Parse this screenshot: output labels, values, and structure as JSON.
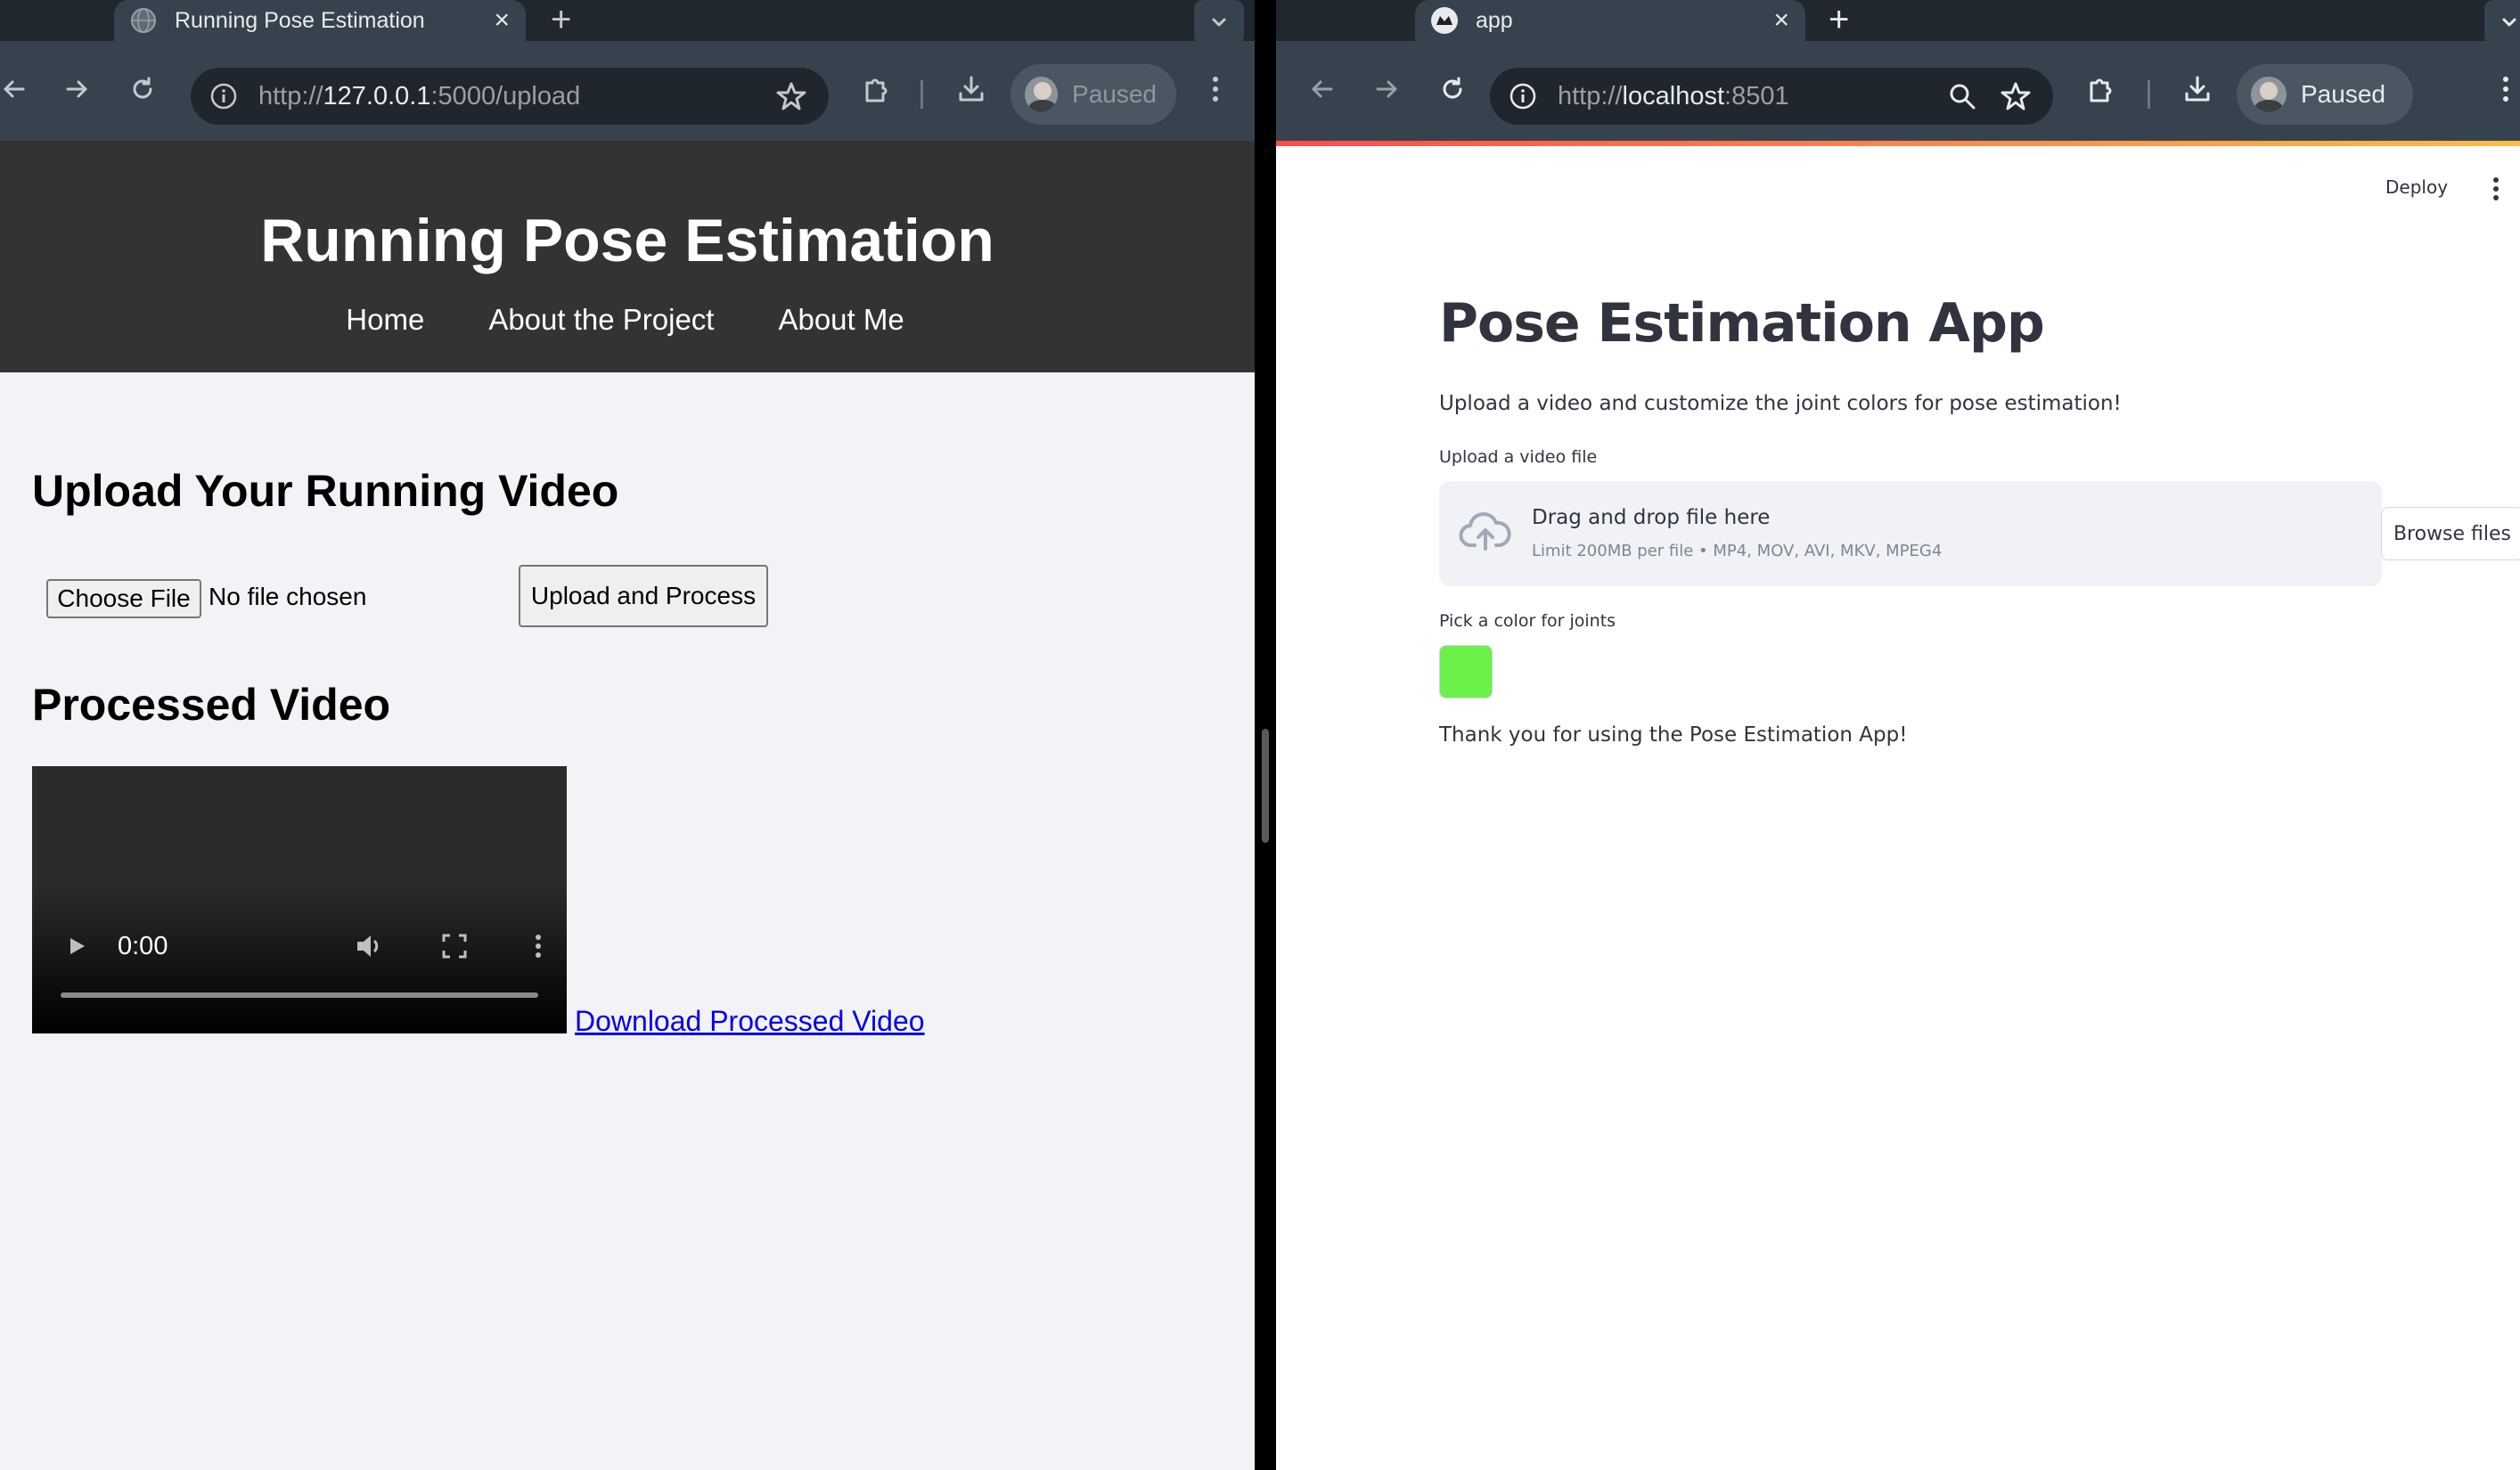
{
  "left_window": {
    "tab": {
      "title": "Running Pose Estimation",
      "close": "×"
    },
    "new_tab": "+",
    "address_bar": {
      "scheme": "http://",
      "host": "127.0.0.1",
      "path": ":5000/upload"
    },
    "profile": {
      "status": "Paused"
    },
    "page": {
      "site_title": "Running Pose Estimation",
      "nav": [
        "Home",
        "About the Project",
        "About Me"
      ],
      "upload_heading": "Upload Your Running Video",
      "file_button": "Choose File",
      "file_status": "No file chosen",
      "upload_button": "Upload and Process",
      "processed_heading": "Processed Video",
      "video": {
        "time": "0:00",
        "progress": 0
      },
      "download_link": "Download Processed Video"
    }
  },
  "right_window": {
    "tab": {
      "title": "app",
      "close": "×"
    },
    "new_tab": "+",
    "address_bar": {
      "scheme": "http://",
      "host": "localhost",
      "path": ":8501"
    },
    "profile": {
      "status": "Paused"
    },
    "page": {
      "deploy": "Deploy",
      "title": "Pose Estimation App",
      "description": "Upload a video and customize the joint colors for pose estimation!",
      "uploader_label": "Upload a video file",
      "dropzone_main": "Drag and drop file here",
      "dropzone_sub": "Limit 200MB per file • MP4, MOV, AVI, MKV, MPEG4",
      "browse_button": "Browse files",
      "color_label": "Pick a color for joints",
      "joint_color": "#6cf04a",
      "thanks": "Thank you for using the Pose Estimation App!"
    }
  },
  "colors": {
    "chrome_tab_strip": "#20272d",
    "chrome_toolbar": "#36434e",
    "site_header": "#333333",
    "page_bg_left": "#f2f2f7",
    "link": "#0000ee",
    "streamlit_text": "#31333f"
  },
  "icons": [
    "globe-icon",
    "streamlit-icon",
    "back-icon",
    "forward-icon",
    "reload-icon",
    "info-icon",
    "star-icon",
    "zoom-icon",
    "extensions-icon",
    "download-icon",
    "kebab-menu-icon",
    "tab-menu-chevron-icon",
    "play-icon",
    "volume-icon",
    "fullscreen-icon",
    "cloud-upload-icon"
  ]
}
